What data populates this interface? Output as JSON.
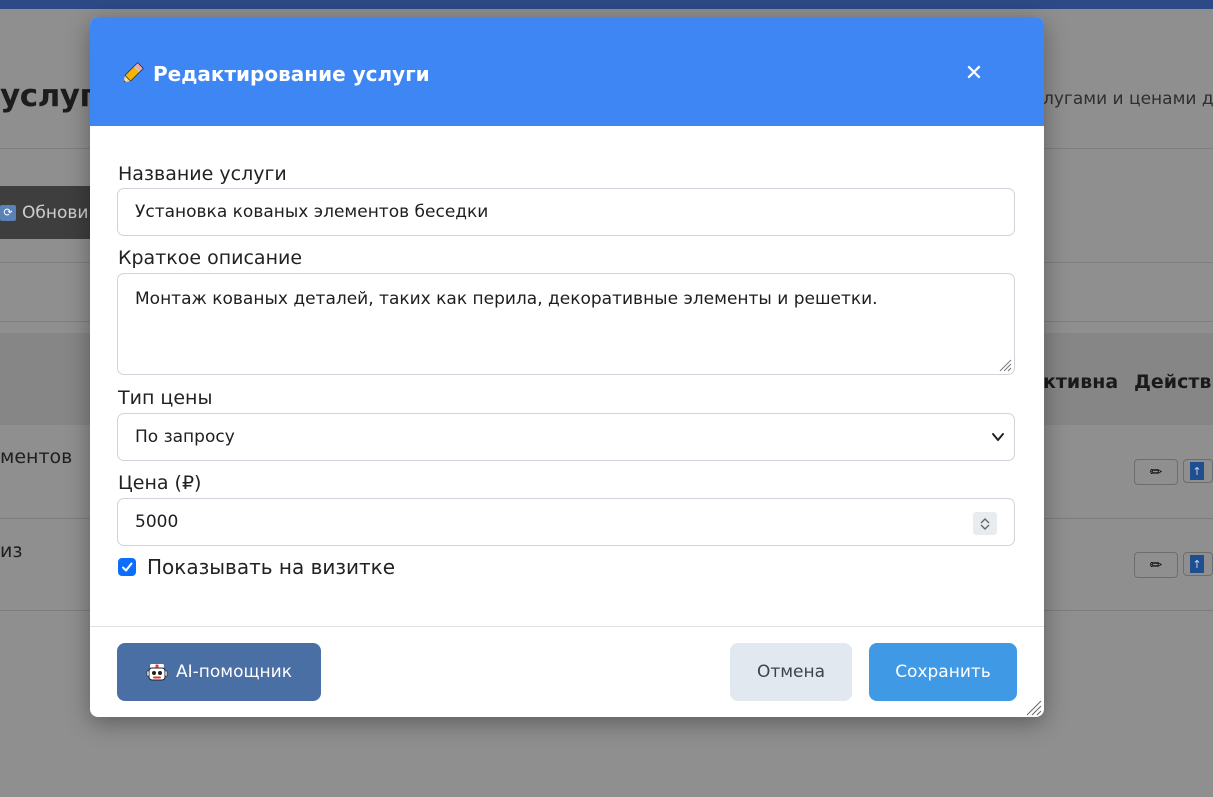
{
  "background": {
    "page_title_fragment": "услуг",
    "page_subtitle_fragment": "лугами и ценами дл",
    "refresh_label": "Обнови",
    "table": {
      "headers": [
        "ктивна",
        "Действи"
      ],
      "rows": [
        {
          "name_fragment": "ментов"
        },
        {
          "name_fragment": "из"
        }
      ]
    }
  },
  "modal": {
    "title": "Редактирование услуги",
    "close_glyph": "✕",
    "fields": {
      "name": {
        "label": "Название услуги",
        "value": "Установка кованых элементов беседки"
      },
      "description": {
        "label": "Краткое описание",
        "value": "Монтаж кованых деталей, таких как перила, декоративные элементы и решетки."
      },
      "price_type": {
        "label": "Тип цены",
        "selected": "По запросу"
      },
      "price": {
        "label": "Цена (₽)",
        "value": "5000"
      }
    },
    "show_on_card": {
      "label": "Показывать на визитке",
      "checked": true
    },
    "buttons": {
      "ai": "AI-помощник",
      "cancel": "Отмена",
      "save": "Сохранить"
    }
  },
  "colors": {
    "header": "#3f86f5",
    "ai_button": "#4a6fa5",
    "cancel_button": "#e1e8f0",
    "save_button": "#4099e5",
    "checkbox": "#0d6efd"
  },
  "icons": [
    "pencil-icon",
    "close-icon",
    "chevron-down-icon",
    "spinner-icon",
    "checkmark-icon",
    "robot-icon",
    "resize-grip-icon",
    "refresh-icon",
    "upload-icon"
  ]
}
